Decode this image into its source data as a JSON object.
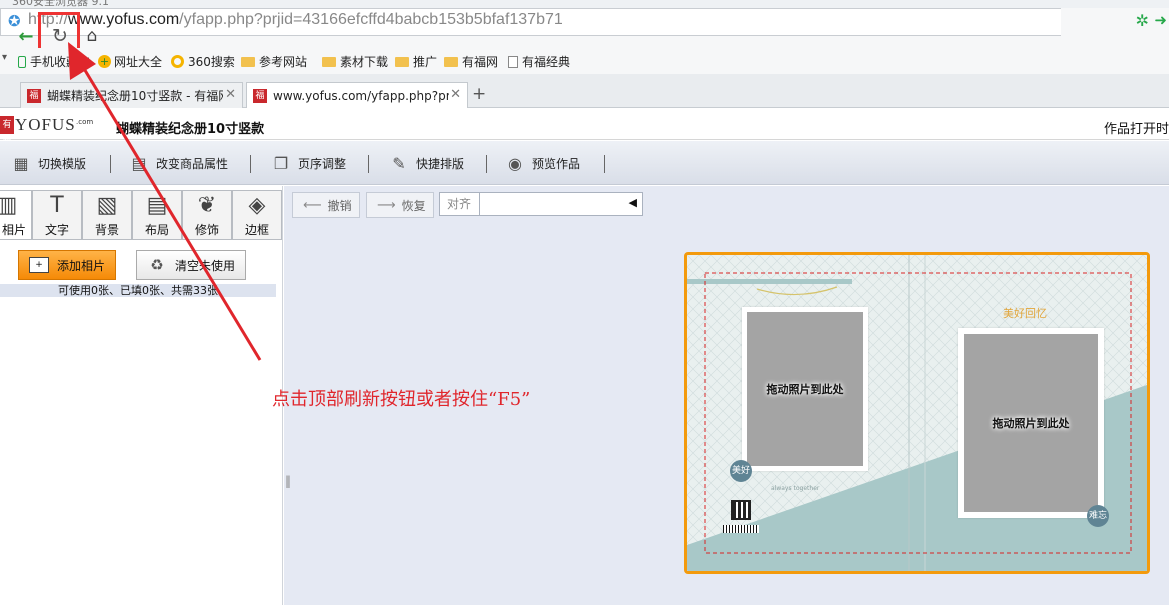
{
  "browser": {
    "window_title": "360安全浏览器 9.1",
    "url_prefix": "http://",
    "url_domain": "www.yofus.com",
    "url_path": "/yfapp.php?prjid=43166efcffd4babcb153b5bfaf137b71",
    "tabs": [
      {
        "label": "蝴蝶精装纪念册10寸竖款 - 有福网",
        "active": false
      },
      {
        "label": "www.yofus.com/yfapp.php?prjid",
        "active": true
      }
    ],
    "bookmarks": [
      {
        "label": "手机收藏夹",
        "icon": "phone-icon"
      },
      {
        "label": "网址大全",
        "icon": "web-directory-icon"
      },
      {
        "label": "360搜索",
        "icon": "search-360-icon"
      },
      {
        "label": "参考网站",
        "icon": "folder-icon"
      },
      {
        "label": "素材下载",
        "icon": "folder-icon"
      },
      {
        "label": "推广",
        "icon": "folder-icon"
      },
      {
        "label": "有福网",
        "icon": "folder-icon"
      },
      {
        "label": "有福经典",
        "icon": "document-icon"
      }
    ]
  },
  "site": {
    "logo_text": "YOFUS",
    "logo_sup": ".com",
    "logo_mark": "有福",
    "product_title": "蝴蝶精装纪念册10寸竖款",
    "open_time": "作品打开时"
  },
  "toolbar": {
    "items": [
      {
        "label": "切换模版"
      },
      {
        "label": "改变商品属性"
      },
      {
        "label": "页序调整"
      },
      {
        "label": "快捷排版"
      },
      {
        "label": "预览作品"
      }
    ]
  },
  "left_panel": {
    "tabs": [
      {
        "label": "相片",
        "icon": "film-icon"
      },
      {
        "label": "文字",
        "icon": "text-icon"
      },
      {
        "label": "背景",
        "icon": "background-icon"
      },
      {
        "label": "布局",
        "icon": "layout-icon"
      },
      {
        "label": "修饰",
        "icon": "feather-icon"
      },
      {
        "label": "边框",
        "icon": "frame-icon"
      }
    ],
    "add_photo_label": "添加相片",
    "clear_unused_label": "清空未使用",
    "usage_text": "可使用0张、已填0张、共需33张"
  },
  "work_area": {
    "undo_label": "撤销",
    "redo_label": "恢复",
    "align_label": "对齐"
  },
  "album": {
    "slot_left_label": "拖动照片到此处",
    "slot_right_label": "拖动照片到此处",
    "badge_left": "美好",
    "badge_right": "难忘",
    "title_decoration": "美好回忆",
    "tagline": "always together"
  },
  "annotation": {
    "text": "点击顶部刷新按钮或者按住“F5”",
    "color": "#e0262c"
  },
  "colors": {
    "album_border": "#f39a0c",
    "add_button": "#f58a07",
    "toolbar_bg": "#d9dee8",
    "workspace_bg": "#e5e9f3"
  }
}
